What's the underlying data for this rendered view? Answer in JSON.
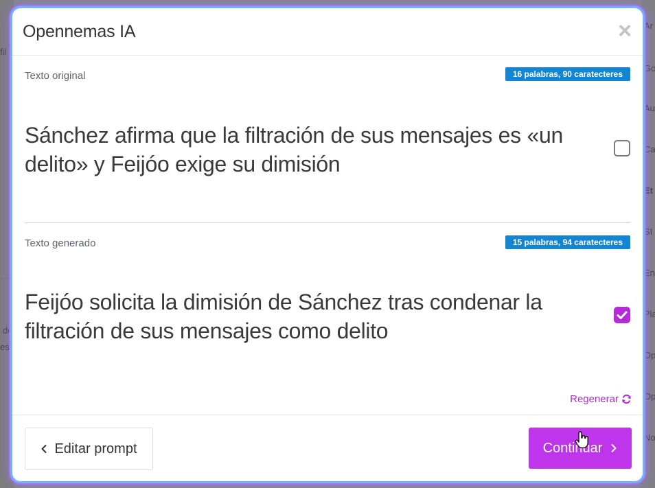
{
  "modal": {
    "title": "Opennemas IA",
    "close_icon": "close-icon"
  },
  "original": {
    "label": "Texto original",
    "badge": "16 palabras, 90 caratecteres",
    "text": "Sánchez afirma que la filtración de sus mensajes es «un delito» y Feijóo exige su dimisión",
    "checked": false
  },
  "generated": {
    "label": "Texto generado",
    "badge": "15 palabras, 94 caratecteres",
    "text": "Feijóo solicita la dimisión de Sánchez tras condenar la filtración de sus mensajes como delito",
    "checked": true
  },
  "actions": {
    "regenerate": "Regenerar",
    "edit_prompt": "Editar prompt",
    "continue": "Continuar"
  },
  "background": {
    "left_words": [
      "fil",
      "de",
      "es"
    ],
    "right_words": [
      "Ar",
      "Go",
      "Au",
      "Ca",
      "Et",
      "SI",
      "En",
      "Pla",
      "Op",
      "Op",
      "No"
    ]
  },
  "colors": {
    "accent": "#bf35ec",
    "badge": "#1385d3",
    "regenerate": "#b22ad3"
  }
}
